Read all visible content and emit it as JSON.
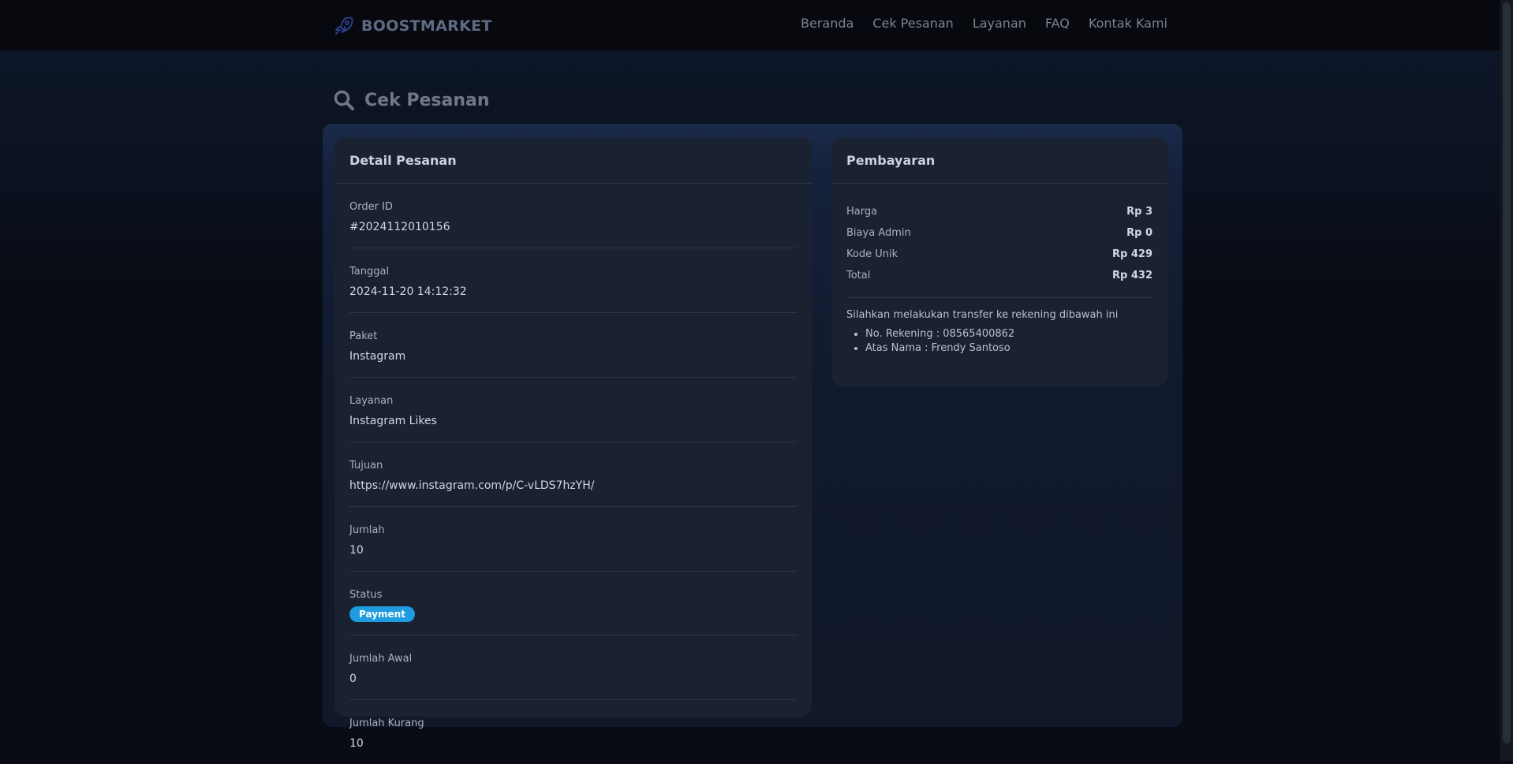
{
  "nav": {
    "brand": "BOOSTMARKET",
    "links": [
      "Beranda",
      "Cek Pesanan",
      "Layanan",
      "FAQ",
      "Kontak Kami"
    ]
  },
  "page": {
    "title": "Cek Pesanan"
  },
  "detail": {
    "title": "Detail Pesanan",
    "fields": [
      {
        "label": "Order ID",
        "value": "#2024112010156"
      },
      {
        "label": "Tanggal",
        "value": "2024-11-20 14:12:32"
      },
      {
        "label": "Paket",
        "value": "Instagram"
      },
      {
        "label": "Layanan",
        "value": "Instagram Likes"
      },
      {
        "label": "Tujuan",
        "value": "https://www.instagram.com/p/C-vLDS7hzYH/"
      },
      {
        "label": "Jumlah",
        "value": "10"
      },
      {
        "label": "Status",
        "value": "Payment"
      },
      {
        "label": "Jumlah Awal",
        "value": "0"
      },
      {
        "label": "Jumlah Kurang",
        "value": "10"
      }
    ]
  },
  "payment": {
    "title": "Pembayaran",
    "rows": [
      {
        "label": "Harga",
        "value": "Rp 3"
      },
      {
        "label": "Biaya Admin",
        "value": "Rp 0"
      },
      {
        "label": "Kode Unik",
        "value": "Rp 429"
      },
      {
        "label": "Total",
        "value": "Rp 432"
      }
    ],
    "instruction": "Silahkan melakukan transfer ke rekening dibawah ini",
    "account": [
      "No. Rekening : 08565400862",
      "Atas Nama : Frendy Santoso"
    ]
  },
  "colors": {
    "status_badge": "#1f9be0",
    "background": "#090c14",
    "card": "#1a2130"
  },
  "icons": {
    "brand": "rocket-icon",
    "page": "search-icon"
  }
}
